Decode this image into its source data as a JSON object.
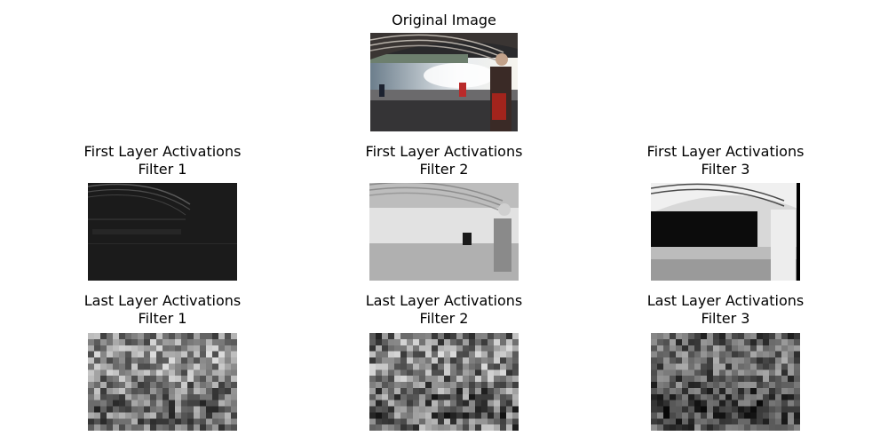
{
  "figure": {
    "original": {
      "title": "Original Image"
    },
    "first_layer": [
      {
        "title": "First Layer Activations\nFilter 1"
      },
      {
        "title": "First Layer Activations\nFilter 2"
      },
      {
        "title": "First Layer Activations\nFilter 3"
      }
    ],
    "last_layer": [
      {
        "title": "Last Layer Activations\nFilter 1"
      },
      {
        "title": "Last Layer Activations\nFilter 2"
      },
      {
        "title": "Last Layer Activations\nFilter 3"
      }
    ]
  }
}
